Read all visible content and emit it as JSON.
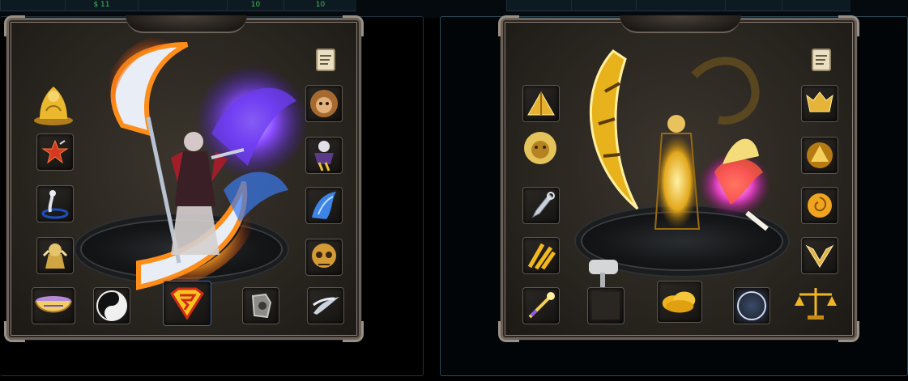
{
  "top_bar": {
    "left_cells": [
      "",
      "$ 11",
      "",
      "10",
      "10"
    ],
    "right_cells": [
      "",
      "",
      "",
      "",
      ""
    ]
  },
  "left_panel": {
    "slots": [
      {
        "name": "golden-buddha-icon",
        "color": "#e7b52a"
      },
      {
        "name": "red-star-icon",
        "color": "#d43a22"
      },
      {
        "name": "serpent-staff-icon",
        "color": "#c9ccd6"
      },
      {
        "name": "golden-idol-icon",
        "color": "#cfa641"
      },
      {
        "name": "crystal-bowl-icon",
        "color": "#b58bd8"
      },
      {
        "name": "yin-yang-icon",
        "color": "#f0f0f0"
      },
      {
        "name": "superman-emblem-icon",
        "color": "#2a63d1"
      },
      {
        "name": "iron-gauntlet-icon",
        "color": "#8d8b87"
      },
      {
        "name": "silver-feather-icon",
        "color": "#c9d3de"
      },
      {
        "name": "lion-head-icon",
        "color": "#c88749"
      },
      {
        "name": "purple-jester-icon",
        "color": "#e2dfe8"
      },
      {
        "name": "blue-spirit-icon",
        "color": "#3e83e6"
      },
      {
        "name": "golden-skull-icon",
        "color": "#d39a36"
      }
    ],
    "accent": "#7a3ef0",
    "fire": "#ff8a1a"
  },
  "right_panel": {
    "slots": [
      {
        "name": "golden-pyramid-icon",
        "color": "#e6b12e"
      },
      {
        "name": "lion-face-icon",
        "color": "#e5c35b"
      },
      {
        "name": "silver-dagger-icon",
        "color": "#c9d0da"
      },
      {
        "name": "golden-runes-icon",
        "color": "#f2b81c"
      },
      {
        "name": "golden-wand-icon",
        "color": "#f3cd57"
      },
      {
        "name": "empty-slot-icon",
        "color": "#2a2622"
      },
      {
        "name": "golden-cloud-icon",
        "color": "#f0b51e"
      },
      {
        "name": "crescent-moon-icon",
        "color": "#e6f0ff"
      },
      {
        "name": "golden-scales-icon",
        "color": "#f1b426"
      },
      {
        "name": "golden-helmet-icon",
        "color": "#e6b43a"
      },
      {
        "name": "triangle-amulet-icon",
        "color": "#f5d05a"
      },
      {
        "name": "golden-rose-icon",
        "color": "#f0a521"
      },
      {
        "name": "golden-wings-icon",
        "color": "#e0b04a"
      },
      {
        "name": "silver-hammer-icon",
        "color": "#d4d6d8"
      }
    ],
    "accent": "#f2c12a",
    "glow": "#e040c0"
  }
}
